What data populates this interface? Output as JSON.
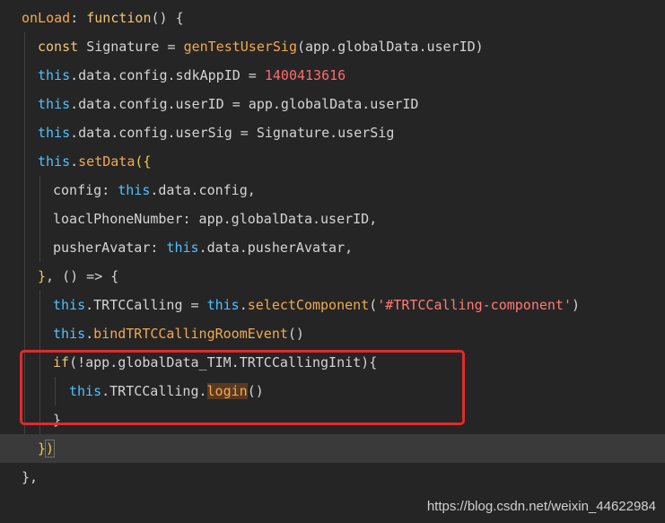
{
  "editor": {
    "lines": [
      {
        "segments": [
          {
            "text": "onLoad",
            "cls": "fn"
          },
          {
            "text": ": ",
            "cls": "pun"
          },
          {
            "text": "function",
            "cls": "kw2"
          },
          {
            "text": "() {",
            "cls": "pun"
          }
        ]
      },
      {
        "segments": [
          {
            "text": "const ",
            "cls": "kw2"
          },
          {
            "text": "Signature",
            "cls": "id"
          },
          {
            "text": " = ",
            "cls": "pun"
          },
          {
            "text": "genTestUserSig",
            "cls": "fn"
          },
          {
            "text": "(app.globalData.userID)",
            "cls": "pun"
          }
        ]
      },
      {
        "segments": [
          {
            "text": "this",
            "cls": "kw"
          },
          {
            "text": ".data.config.sdkAppID = ",
            "cls": "pun"
          },
          {
            "text": "1400413616",
            "cls": "num"
          }
        ]
      },
      {
        "segments": [
          {
            "text": "this",
            "cls": "kw"
          },
          {
            "text": ".data.config.userID = app.globalData.userID",
            "cls": "pun"
          }
        ]
      },
      {
        "segments": [
          {
            "text": "this",
            "cls": "kw"
          },
          {
            "text": ".data.config.userSig = Signature.userSig",
            "cls": "pun"
          }
        ]
      },
      {
        "segments": [
          {
            "text": "this",
            "cls": "kw"
          },
          {
            "text": ".",
            "cls": "pun"
          },
          {
            "text": "setData",
            "cls": "fn"
          },
          {
            "text": "(",
            "cls": "brace"
          },
          {
            "text": "{",
            "cls": "brace"
          }
        ]
      },
      {
        "segments": [
          {
            "text": "config",
            "cls": "prop"
          },
          {
            "text": ": ",
            "cls": "pun"
          },
          {
            "text": "this",
            "cls": "kw"
          },
          {
            "text": ".data.config,",
            "cls": "pun"
          }
        ]
      },
      {
        "segments": [
          {
            "text": "loaclPhoneNumber",
            "cls": "prop"
          },
          {
            "text": ": app.globalData.userID,",
            "cls": "pun"
          }
        ]
      },
      {
        "segments": [
          {
            "text": "pusherAvatar",
            "cls": "prop"
          },
          {
            "text": ": ",
            "cls": "pun"
          },
          {
            "text": "this",
            "cls": "kw"
          },
          {
            "text": ".data.pusherAvatar,",
            "cls": "pun"
          }
        ]
      },
      {
        "segments": [
          {
            "text": "}",
            "cls": "brace"
          },
          {
            "text": ", () => {",
            "cls": "pun"
          }
        ]
      },
      {
        "segments": [
          {
            "text": "this",
            "cls": "kw"
          },
          {
            "text": ".TRTCCalling = ",
            "cls": "pun"
          },
          {
            "text": "this",
            "cls": "kw"
          },
          {
            "text": ".",
            "cls": "pun"
          },
          {
            "text": "selectComponent",
            "cls": "fn"
          },
          {
            "text": "(",
            "cls": "pun"
          },
          {
            "text": "'#TRTCCalling-component'",
            "cls": "str"
          },
          {
            "text": ")",
            "cls": "pun"
          }
        ]
      },
      {
        "segments": [
          {
            "text": "this",
            "cls": "kw"
          },
          {
            "text": ".",
            "cls": "pun"
          },
          {
            "text": "bindTRTCCallingRoomEvent",
            "cls": "fn"
          },
          {
            "text": "()",
            "cls": "pun"
          }
        ]
      },
      {
        "segments": [
          {
            "text": "if",
            "cls": "kw2"
          },
          {
            "text": "(!app.globalData_TIM.TRTCCallingInit){",
            "cls": "pun"
          }
        ]
      },
      {
        "segments": [
          {
            "text": "this",
            "cls": "kw"
          },
          {
            "text": ".TRTCCalling.",
            "cls": "pun"
          },
          {
            "text": "login",
            "cls": "call"
          },
          {
            "text": "()",
            "cls": "pun"
          }
        ]
      },
      {
        "segments": [
          {
            "text": "}",
            "cls": "pun"
          }
        ]
      },
      {
        "segments": [
          {
            "text": "}",
            "cls": "brace"
          },
          {
            "text": ")",
            "cls": "brace-box-paren"
          }
        ]
      },
      {
        "segments": [
          {
            "text": "},",
            "cls": "pun"
          }
        ]
      }
    ]
  },
  "watermark": "https://blog.csdn.net/weixin_44622984",
  "colors": {
    "background": "#252526",
    "highlight_border": "#e02b2b"
  }
}
